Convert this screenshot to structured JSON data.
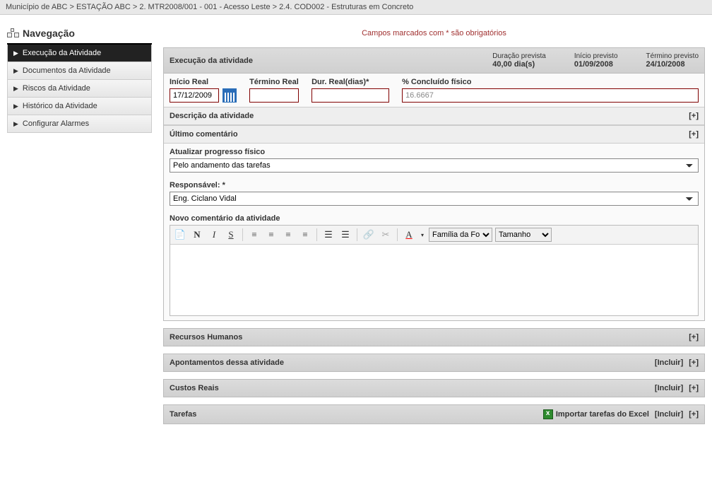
{
  "breadcrumb": "Município de ABC > ESTAÇÃO ABC > 2. MTR2008/001 - 001 - Acesso Leste > 2.4. COD002 - Estruturas em Concreto",
  "sidebar": {
    "title": "Navegação",
    "items": [
      {
        "label": "Execução da Atividade"
      },
      {
        "label": "Documentos da Atividade"
      },
      {
        "label": "Riscos da Atividade"
      },
      {
        "label": "Histórico da Atividade"
      },
      {
        "label": "Configurar Alarmes"
      }
    ]
  },
  "required_note": "Campos marcados com * são obrigatórios",
  "exec_panel": {
    "title": "Execução da atividade",
    "duracao_label": "Duração prevista",
    "duracao_val": "40,00 dia(s)",
    "inicio_label": "Início previsto",
    "inicio_val": "01/09/2008",
    "termino_label": "Término previsto",
    "termino_val": "24/10/2008",
    "inicio_real_label": "Início Real",
    "inicio_real_val": "17/12/2009",
    "termino_real_label": "Término Real",
    "termino_real_val": "",
    "dur_real_label": "Dur. Real(dias)*",
    "dur_real_val": "",
    "concluido_label": "% Concluído físico",
    "concluido_val": "16.6667",
    "descricao_title": "Descrição da atividade",
    "ultimo_title": "Último comentário",
    "atualizar_label": "Atualizar progresso físico",
    "atualizar_val": "Pelo andamento das tarefas",
    "responsavel_label": "Responsável: *",
    "responsavel_val": "Eng. Ciclano Vidal",
    "novo_label": "Novo comentário da atividade",
    "expand": "[+]"
  },
  "toolbar": {
    "fontfamily": "Família da Fon",
    "fontsize": "Tamanho"
  },
  "panels": {
    "rh": "Recursos Humanos",
    "apont": "Apontamentos dessa atividade",
    "custos": "Custos Reais",
    "tarefas": "Tarefas",
    "incluir": "[Incluir]",
    "import": "Importar tarefas do Excel",
    "expand": "[+]"
  }
}
